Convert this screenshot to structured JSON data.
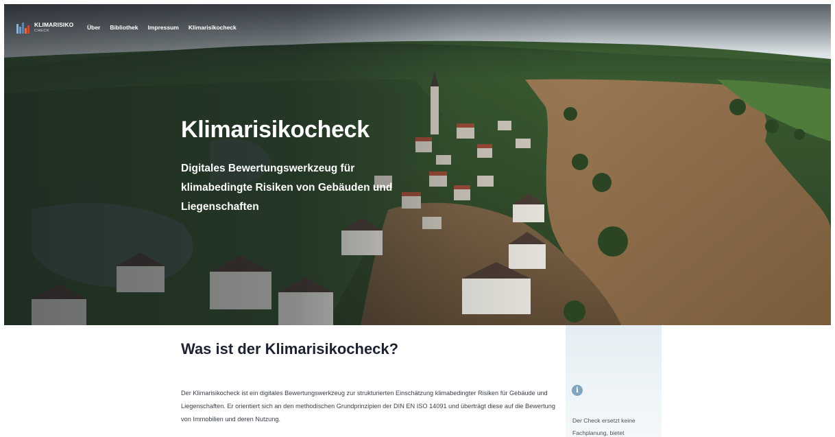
{
  "nav": {
    "logo_title": "KLIMARISIKO",
    "logo_subtitle": "CHECK",
    "items": [
      {
        "label": "Über"
      },
      {
        "label": "Bibliothek"
      },
      {
        "label": "Impressum"
      },
      {
        "label": "Klimarisikocheck"
      }
    ]
  },
  "hero": {
    "title": "Klimarisikocheck",
    "subtitle": "Digitales Bewertungswerkzeug für klimabedingte Risiken von Gebäuden und Liegenschaften",
    "image": "flooded-village-aerial-photo"
  },
  "intro": {
    "heading": "Was ist der Klimarisikocheck?",
    "body": "Der Klimarisikocheck ist ein digitales Bewertungswerkzeug zur strukturierten Einschätzung klimabedingter Risiken für Gebäude und Liegenschaften. Er orientiert sich an den methodischen Grundprinzipien der DIN EN ISO 14091 und überträgt diese auf die Bewertung von Immobilien und deren Nutzung."
  },
  "aside": {
    "icon": "info-icon",
    "text": "Der Check ersetzt keine Fachplanung, bietet"
  },
  "colors": {
    "accent": "#7fa5c0",
    "aside_bg": "#e5eef3",
    "heading": "#1d2230"
  }
}
